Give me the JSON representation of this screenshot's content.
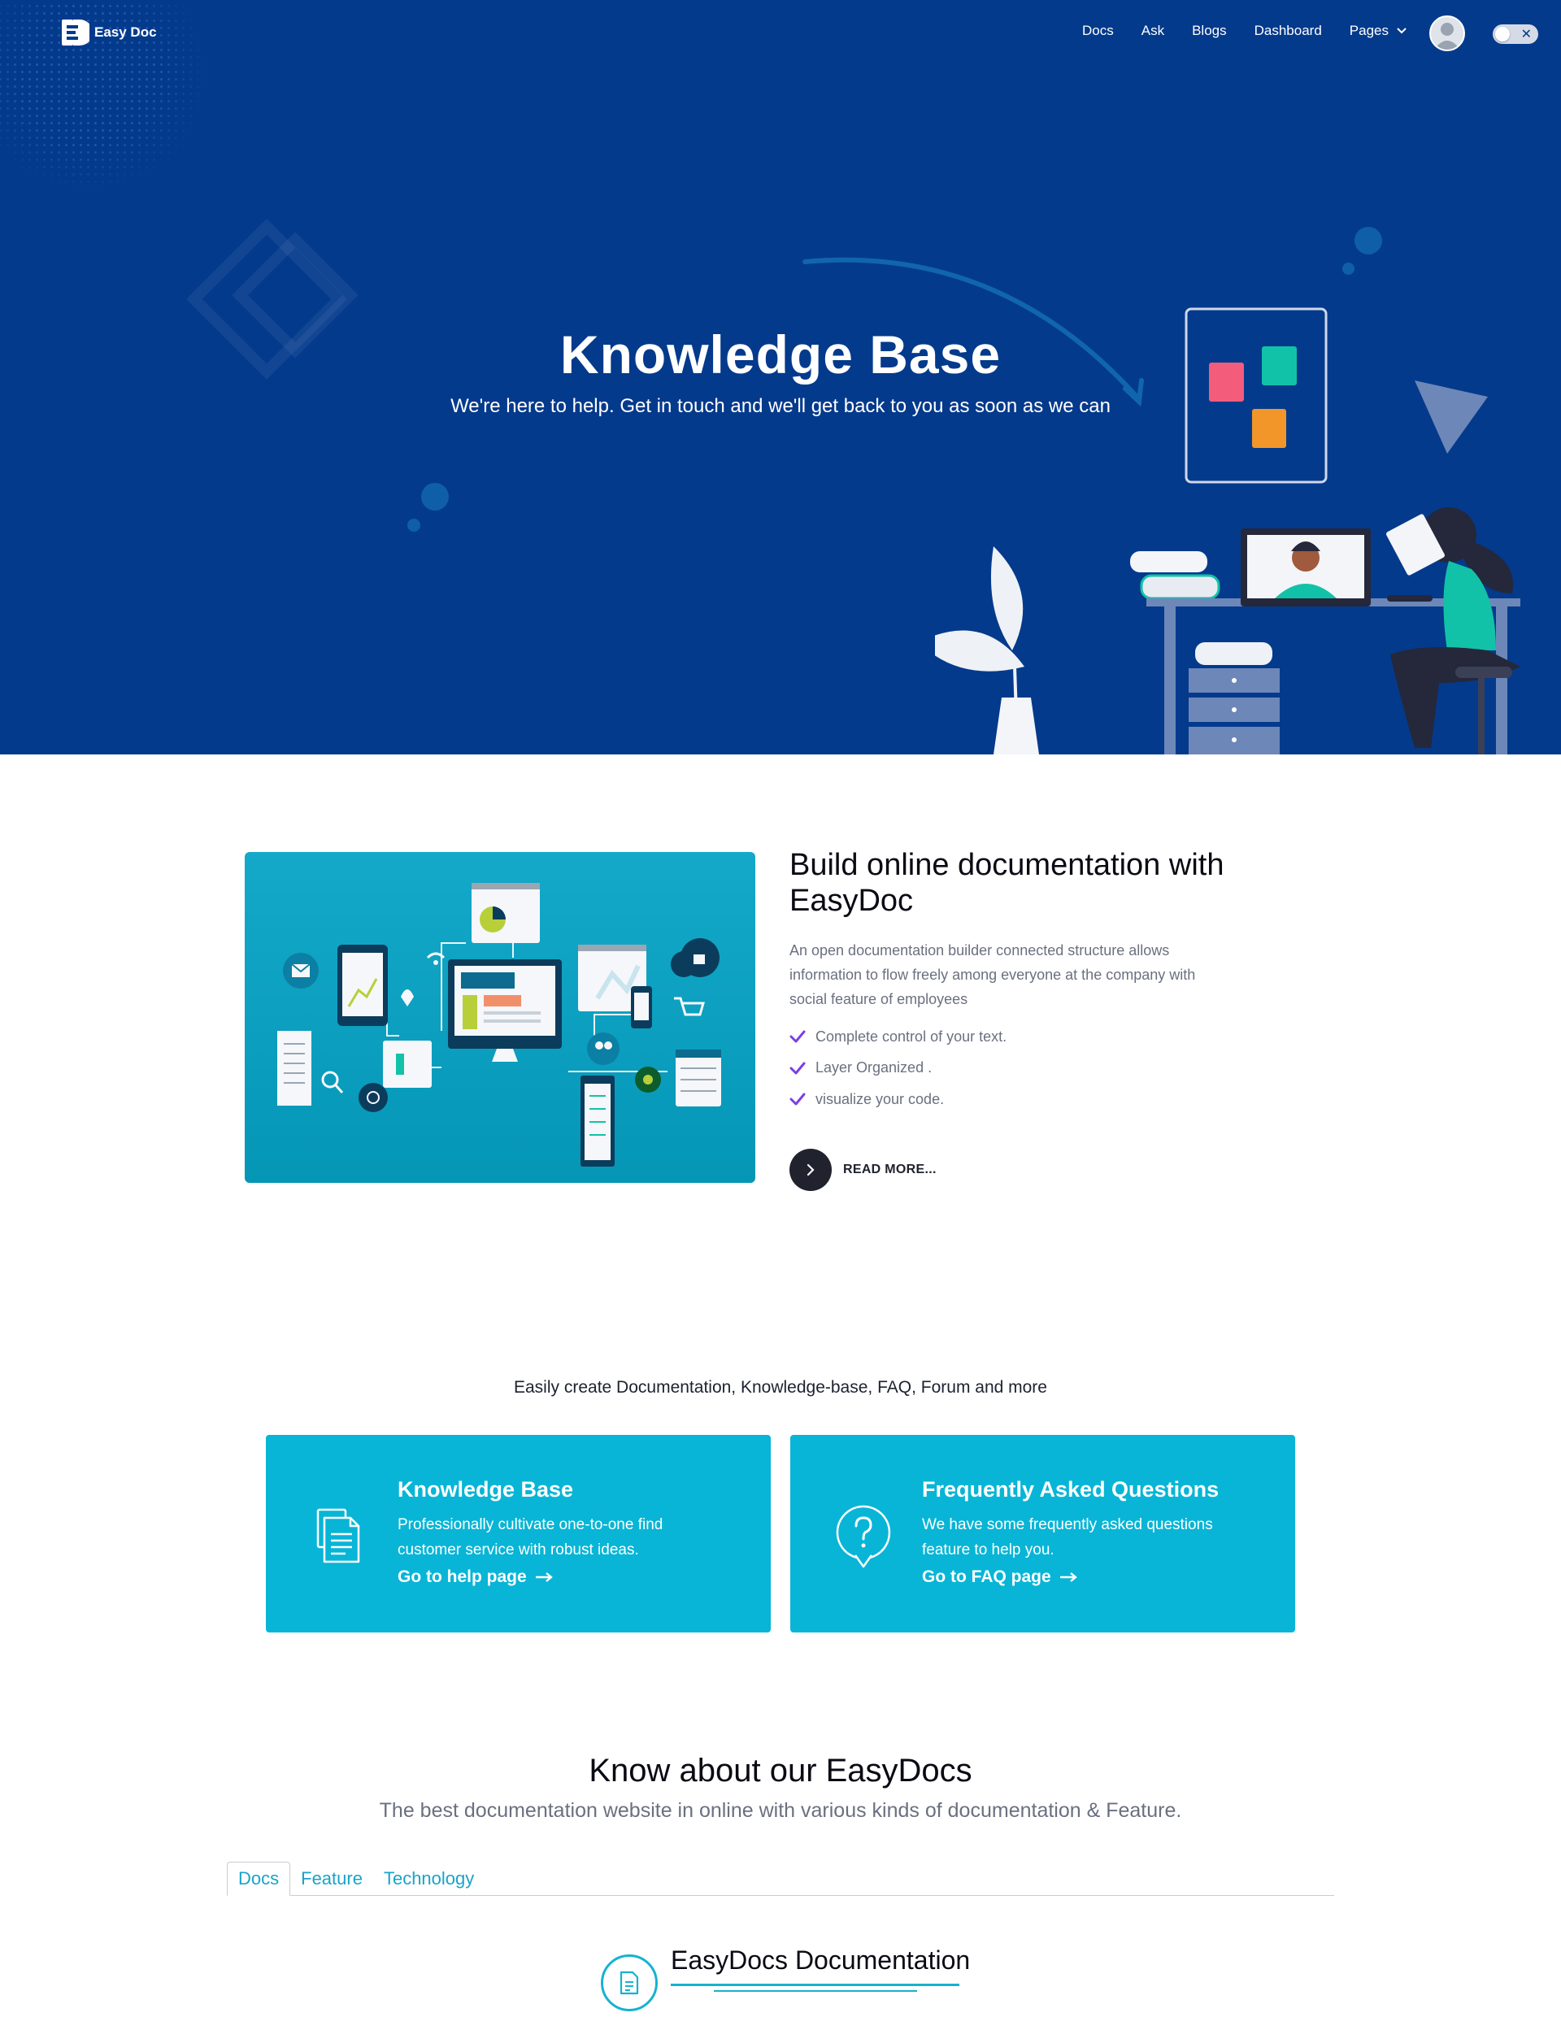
{
  "brand": {
    "name": "Easy Doc"
  },
  "nav": {
    "items": [
      {
        "label": "Docs"
      },
      {
        "label": "Ask"
      },
      {
        "label": "Blogs"
      },
      {
        "label": "Dashboard"
      },
      {
        "label": "Pages"
      }
    ]
  },
  "hero": {
    "title": "Knowledge Base",
    "subtitle": "We're here to help. Get in touch and we'll get back to you as soon as we can"
  },
  "build": {
    "title": "Build online documentation with EasyDoc",
    "description": "An open documentation builder connected structure allows information to flow freely among everyone at the company with social feature of employees",
    "features": [
      "Complete control of your text.",
      "Layer Organized .",
      "visualize your code."
    ],
    "read_more": "READ MORE..."
  },
  "services": {
    "heading": "Easily create Documentation, Knowledge-base, FAQ, Forum and more",
    "cards": [
      {
        "title": "Knowledge Base",
        "description": "Professionally cultivate one-to-one find customer service with robust ideas.",
        "link": "Go to help page",
        "icon": "document-stack-icon"
      },
      {
        "title": "Frequently Asked Questions",
        "description": "We have some frequently asked questions feature to help you.",
        "link": "Go to FAQ page",
        "icon": "question-bubble-icon"
      }
    ]
  },
  "know": {
    "title": "Know about our EasyDocs",
    "subtitle": "The best documentation website in online with various kinds of documentation & Feature.",
    "tabs": [
      {
        "label": "Docs"
      },
      {
        "label": "Feature"
      },
      {
        "label": "Technology"
      }
    ],
    "active_tab": "Docs",
    "doc_title": "EasyDocs Documentation"
  },
  "colors": {
    "hero_bg": "#043a8c",
    "card_bg": "#08b5d6",
    "accent": "#17b2cf",
    "check": "#7b3fe4"
  }
}
